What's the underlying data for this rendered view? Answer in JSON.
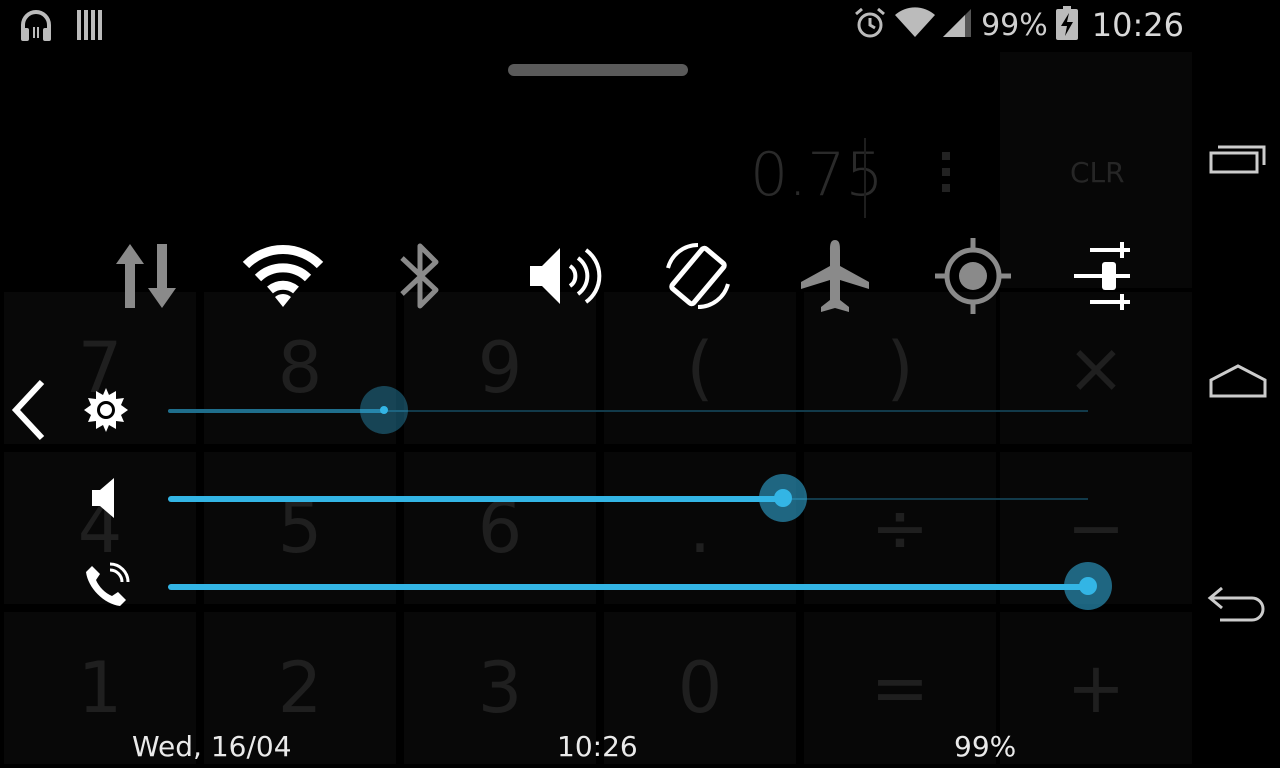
{
  "status_bar": {
    "icons_left": [
      "headphones-icon",
      "bars-icon"
    ],
    "icons_right": [
      "alarm-icon",
      "wifi-icon",
      "signal-icon"
    ],
    "battery_percent": "99%",
    "time": "10:26"
  },
  "calculator": {
    "display_value": "0.75",
    "clear_label": "CLR",
    "keys": {
      "row1": [
        "7",
        "8",
        "9",
        "(",
        ")",
        "×"
      ],
      "row2": [
        "4",
        "5",
        "6",
        ".",
        "÷",
        "−"
      ],
      "row3": [
        "1",
        "2",
        "3",
        "0",
        "=",
        "+"
      ]
    }
  },
  "quick_settings": {
    "toggles": [
      {
        "icon": "data-transfer-icon",
        "active": false
      },
      {
        "icon": "wifi-icon",
        "active": true
      },
      {
        "icon": "bluetooth-icon",
        "active": false
      },
      {
        "icon": "sound-icon",
        "active": true
      },
      {
        "icon": "auto-rotate-icon",
        "active": true
      },
      {
        "icon": "airplane-mode-icon",
        "active": false
      },
      {
        "icon": "gps-icon",
        "active": false
      },
      {
        "icon": "settings-sliders-icon",
        "active": true
      }
    ]
  },
  "sliders": {
    "brightness": {
      "icon": "brightness-icon",
      "value": 0.235
    },
    "media_volume": {
      "icon": "speaker-icon",
      "value": 0.668
    },
    "ringer_volume": {
      "icon": "phone-ringer-icon",
      "value": 1.0
    }
  },
  "footer": {
    "date": "Wed, 16/04",
    "time": "10:26",
    "battery": "99%"
  },
  "accent_color": "#33b5e5"
}
